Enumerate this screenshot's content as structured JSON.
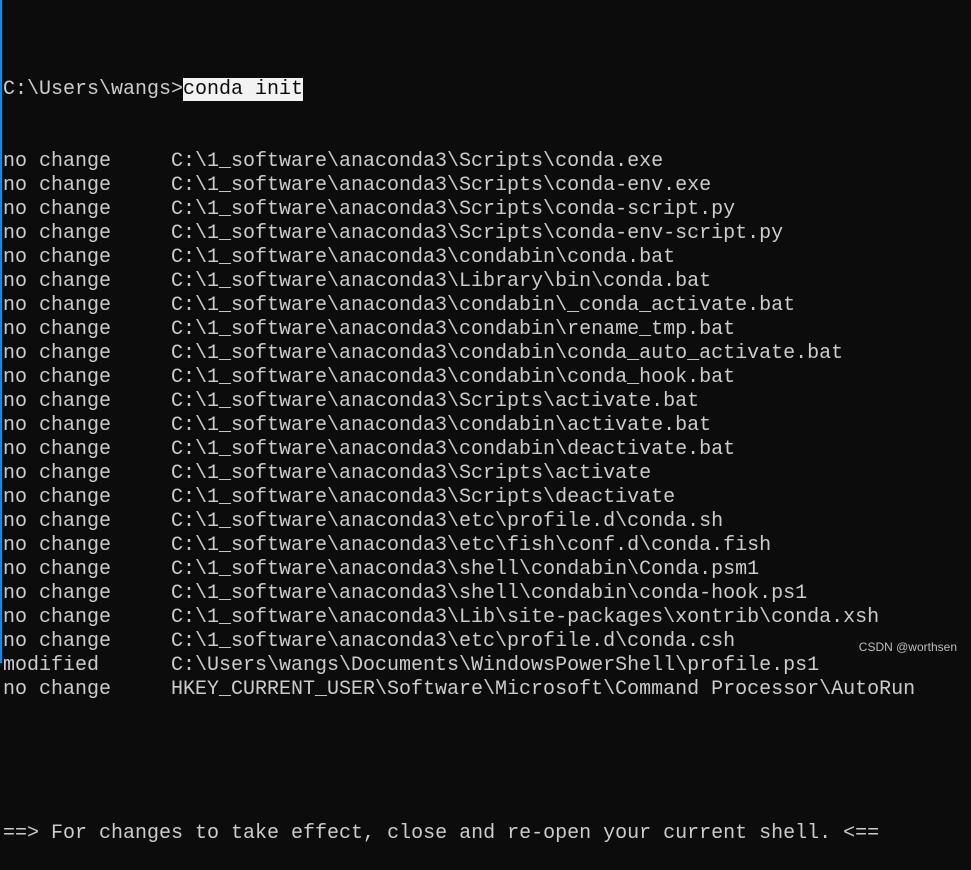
{
  "prompt": {
    "path": "C:\\Users\\wangs>",
    "command": "conda init"
  },
  "rows": [
    {
      "status": "no change",
      "path": "C:\\1_software\\anaconda3\\Scripts\\conda.exe"
    },
    {
      "status": "no change",
      "path": "C:\\1_software\\anaconda3\\Scripts\\conda-env.exe"
    },
    {
      "status": "no change",
      "path": "C:\\1_software\\anaconda3\\Scripts\\conda-script.py"
    },
    {
      "status": "no change",
      "path": "C:\\1_software\\anaconda3\\Scripts\\conda-env-script.py"
    },
    {
      "status": "no change",
      "path": "C:\\1_software\\anaconda3\\condabin\\conda.bat"
    },
    {
      "status": "no change",
      "path": "C:\\1_software\\anaconda3\\Library\\bin\\conda.bat"
    },
    {
      "status": "no change",
      "path": "C:\\1_software\\anaconda3\\condabin\\_conda_activate.bat"
    },
    {
      "status": "no change",
      "path": "C:\\1_software\\anaconda3\\condabin\\rename_tmp.bat"
    },
    {
      "status": "no change",
      "path": "C:\\1_software\\anaconda3\\condabin\\conda_auto_activate.bat"
    },
    {
      "status": "no change",
      "path": "C:\\1_software\\anaconda3\\condabin\\conda_hook.bat"
    },
    {
      "status": "no change",
      "path": "C:\\1_software\\anaconda3\\Scripts\\activate.bat"
    },
    {
      "status": "no change",
      "path": "C:\\1_software\\anaconda3\\condabin\\activate.bat"
    },
    {
      "status": "no change",
      "path": "C:\\1_software\\anaconda3\\condabin\\deactivate.bat"
    },
    {
      "status": "no change",
      "path": "C:\\1_software\\anaconda3\\Scripts\\activate"
    },
    {
      "status": "no change",
      "path": "C:\\1_software\\anaconda3\\Scripts\\deactivate"
    },
    {
      "status": "no change",
      "path": "C:\\1_software\\anaconda3\\etc\\profile.d\\conda.sh"
    },
    {
      "status": "no change",
      "path": "C:\\1_software\\anaconda3\\etc\\fish\\conf.d\\conda.fish"
    },
    {
      "status": "no change",
      "path": "C:\\1_software\\anaconda3\\shell\\condabin\\Conda.psm1"
    },
    {
      "status": "no change",
      "path": "C:\\1_software\\anaconda3\\shell\\condabin\\conda-hook.ps1"
    },
    {
      "status": "no change",
      "path": "C:\\1_software\\anaconda3\\Lib\\site-packages\\xontrib\\conda.xsh"
    },
    {
      "status": "no change",
      "path": "C:\\1_software\\anaconda3\\etc\\profile.d\\conda.csh"
    },
    {
      "status": "modified",
      "path": "C:\\Users\\wangs\\Documents\\WindowsPowerShell\\profile.ps1"
    },
    {
      "status": "no change",
      "path": "HKEY_CURRENT_USER\\Software\\Microsoft\\Command Processor\\AutoRun"
    }
  ],
  "footer": "==> For changes to take effect, close and re-open your current shell. <==",
  "watermark": "CSDN @worthsen",
  "colors": {
    "background": "#0c0c0c",
    "text": "#cccccc",
    "border": "#1c8ad0"
  }
}
